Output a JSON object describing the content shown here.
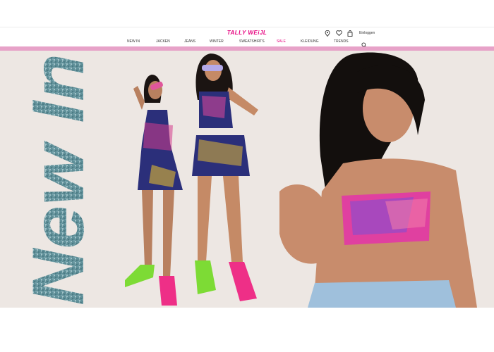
{
  "brand": {
    "logo": "TALLY WEiJL",
    "accent": "#e6007e",
    "bar_color": "#e7a2c8"
  },
  "header": {
    "icons": [
      "location-pin-icon",
      "heart-icon",
      "shopping-bag-icon"
    ],
    "login_label": "Einloggen"
  },
  "nav": {
    "items": [
      {
        "label": "NEW IN"
      },
      {
        "label": "JACKEN"
      },
      {
        "label": "JEANS"
      },
      {
        "label": "WINTER"
      },
      {
        "label": "SWEATSHIRTS"
      },
      {
        "label": "SALE"
      },
      {
        "label": "KLEIDUNG"
      },
      {
        "label": "TRENDS"
      }
    ],
    "search_icon": "search-icon"
  },
  "hero": {
    "headline": "New In",
    "background": "#ede7e3"
  }
}
